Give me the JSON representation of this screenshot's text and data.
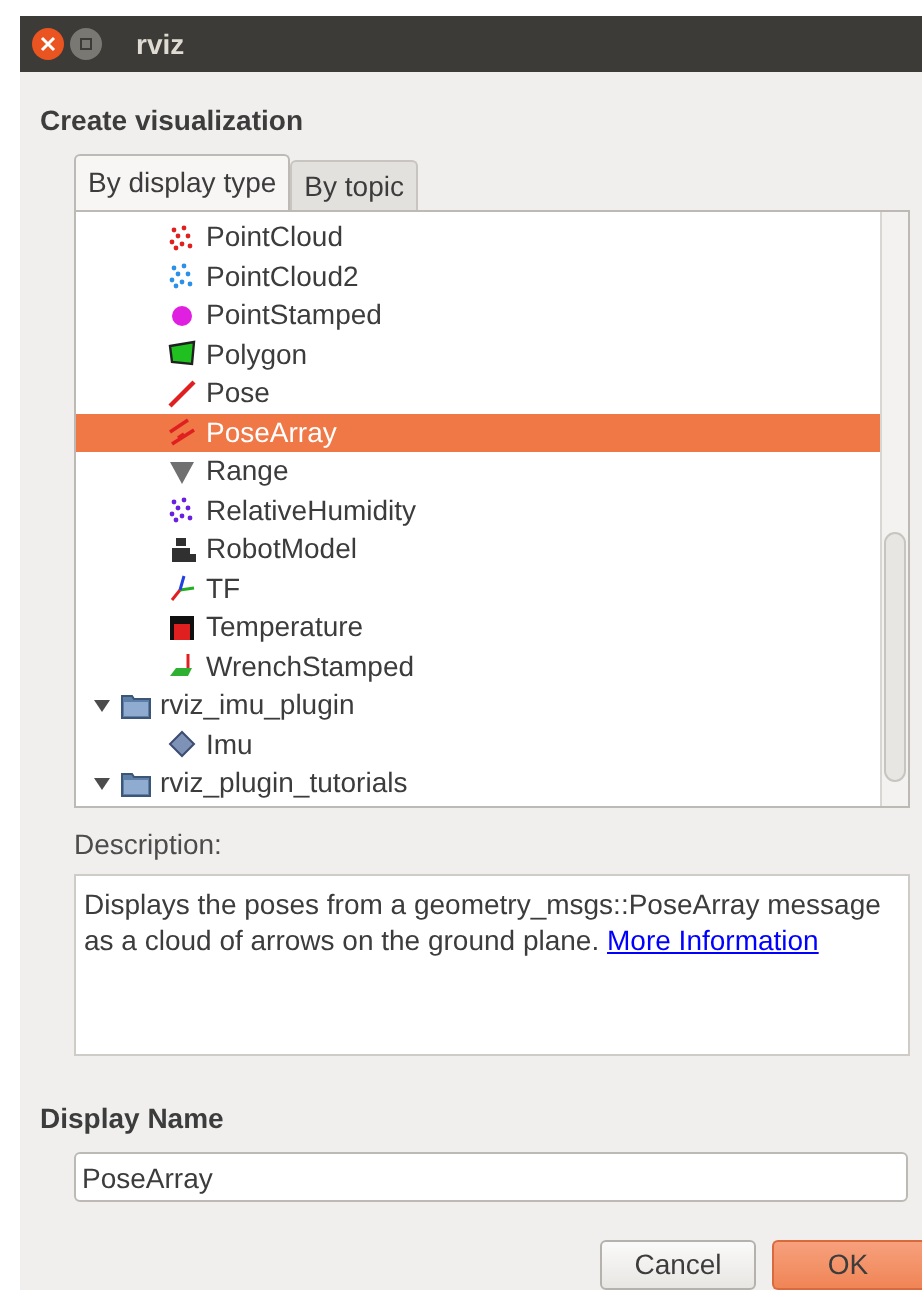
{
  "window": {
    "title": "rviz"
  },
  "heading": "Create visualization",
  "tabs": [
    {
      "label": "By display type",
      "selected": true
    },
    {
      "label": "By topic",
      "selected": false
    }
  ],
  "tree": [
    {
      "kind": "continued",
      "children": [
        {
          "label": "PointCloud",
          "selected": false
        },
        {
          "label": "PointCloud2",
          "selected": false
        },
        {
          "label": "PointStamped",
          "selected": false
        },
        {
          "label": "Polygon",
          "selected": false
        },
        {
          "label": "Pose",
          "selected": false
        },
        {
          "label": "PoseArray",
          "selected": true
        },
        {
          "label": "Range",
          "selected": false
        },
        {
          "label": "RelativeHumidity",
          "selected": false
        },
        {
          "label": "RobotModel",
          "selected": false
        },
        {
          "label": "TF",
          "selected": false
        },
        {
          "label": "Temperature",
          "selected": false
        },
        {
          "label": "WrenchStamped",
          "selected": false
        }
      ]
    },
    {
      "kind": "folder",
      "label": "rviz_imu_plugin",
      "expanded": true,
      "children": [
        {
          "label": "Imu",
          "selected": false
        }
      ]
    },
    {
      "kind": "folder",
      "label": "rviz_plugin_tutorials",
      "expanded": true
    }
  ],
  "description": {
    "label": "Description:",
    "text": "Displays the poses from a geometry_msgs::PoseArray message as a cloud of arrows on the ground plane.",
    "link": "More Information"
  },
  "display_name": {
    "label": "Display Name",
    "value": "PoseArray"
  },
  "buttons": [
    {
      "label": "Cancel",
      "kind": "default"
    },
    {
      "label": "OK",
      "kind": "primary"
    }
  ]
}
